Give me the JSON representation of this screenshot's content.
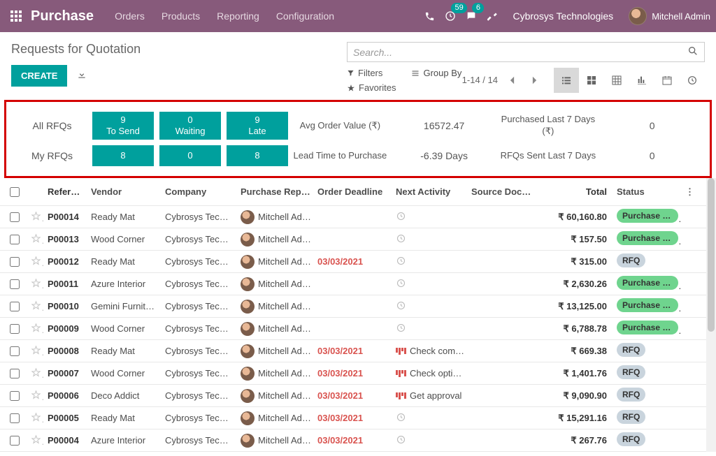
{
  "nav": {
    "brand": "Purchase",
    "links": [
      "Orders",
      "Products",
      "Reporting",
      "Configuration"
    ],
    "msg_badge": "59",
    "chat_badge": "6",
    "company": "Cybrosys Technologies",
    "user": "Mitchell Admin"
  },
  "header": {
    "title": "Requests for Quotation",
    "create": "CREATE",
    "search_ph": "Search...",
    "filters": "Filters",
    "groupby": "Group By",
    "favorites": "Favorites",
    "pager": "1-14 / 14"
  },
  "dash": {
    "all_label": "All RFQs",
    "my_label": "My RFQs",
    "all": [
      {
        "n": "9",
        "t": "To Send"
      },
      {
        "n": "0",
        "t": "Waiting"
      },
      {
        "n": "9",
        "t": "Late"
      }
    ],
    "my": [
      "8",
      "0",
      "8"
    ],
    "avg_lbl": "Avg Order Value (₹)",
    "avg_val": "16572.47",
    "lead_lbl": "Lead Time to Purchase",
    "lead_val": "-6.39  Days",
    "pur_lbl": "Purchased Last 7 Days (₹)",
    "pur_val": "0",
    "sent_lbl": "RFQs Sent Last 7 Days",
    "sent_val": "0"
  },
  "cols": {
    "ref": "Referen…",
    "vendor": "Vendor",
    "company": "Company",
    "rep": "Purchase Rep…",
    "deadline": "Order Deadline",
    "activity": "Next Activity",
    "src": "Source Docu…",
    "total": "Total",
    "status": "Status"
  },
  "rows": [
    {
      "ref": "P00014",
      "vendor": "Ready Mat",
      "company": "Cybrosys Techn…",
      "rep": "Mitchell Ad…",
      "deadline": "",
      "overdue": false,
      "act": "",
      "act_t": "clock",
      "total": "₹ 60,160.80",
      "status": "Purchase Or…",
      "st": "po"
    },
    {
      "ref": "P00013",
      "vendor": "Wood Corner",
      "company": "Cybrosys Techn…",
      "rep": "Mitchell Ad…",
      "deadline": "",
      "overdue": false,
      "act": "",
      "act_t": "clock",
      "total": "₹ 157.50",
      "status": "Purchase Or…",
      "st": "po"
    },
    {
      "ref": "P00012",
      "vendor": "Ready Mat",
      "company": "Cybrosys Techn…",
      "rep": "Mitchell Ad…",
      "deadline": "03/03/2021",
      "overdue": true,
      "act": "",
      "act_t": "clock",
      "total": "₹ 315.00",
      "status": "RFQ",
      "st": "rfq"
    },
    {
      "ref": "P00011",
      "vendor": "Azure Interior",
      "company": "Cybrosys Techn…",
      "rep": "Mitchell Ad…",
      "deadline": "",
      "overdue": false,
      "act": "",
      "act_t": "clock",
      "total": "₹ 2,630.26",
      "status": "Purchase Or…",
      "st": "po"
    },
    {
      "ref": "P00010",
      "vendor": "Gemini Furniture",
      "company": "Cybrosys Techn…",
      "rep": "Mitchell Ad…",
      "deadline": "",
      "overdue": false,
      "act": "",
      "act_t": "clock",
      "total": "₹ 13,125.00",
      "status": "Purchase Or…",
      "st": "po"
    },
    {
      "ref": "P00009",
      "vendor": "Wood Corner",
      "company": "Cybrosys Techn…",
      "rep": "Mitchell Ad…",
      "deadline": "",
      "overdue": false,
      "act": "",
      "act_t": "clock",
      "total": "₹ 6,788.78",
      "status": "Purchase Or…",
      "st": "po"
    },
    {
      "ref": "P00008",
      "vendor": "Ready Mat",
      "company": "Cybrosys Techn…",
      "rep": "Mitchell Ad…",
      "deadline": "03/03/2021",
      "overdue": true,
      "act": "Check com…",
      "act_t": "bars",
      "total": "₹ 669.38",
      "status": "RFQ",
      "st": "rfq"
    },
    {
      "ref": "P00007",
      "vendor": "Wood Corner",
      "company": "Cybrosys Techn…",
      "rep": "Mitchell Ad…",
      "deadline": "03/03/2021",
      "overdue": true,
      "act": "Check opti…",
      "act_t": "bars",
      "total": "₹ 1,401.76",
      "status": "RFQ",
      "st": "rfq"
    },
    {
      "ref": "P00006",
      "vendor": "Deco Addict",
      "company": "Cybrosys Techn…",
      "rep": "Mitchell Ad…",
      "deadline": "03/03/2021",
      "overdue": true,
      "act": "Get approval",
      "act_t": "bars",
      "total": "₹ 9,090.90",
      "status": "RFQ",
      "st": "rfq"
    },
    {
      "ref": "P00005",
      "vendor": "Ready Mat",
      "company": "Cybrosys Techn…",
      "rep": "Mitchell Ad…",
      "deadline": "03/03/2021",
      "overdue": true,
      "act": "",
      "act_t": "clock",
      "total": "₹ 15,291.16",
      "status": "RFQ",
      "st": "rfq"
    },
    {
      "ref": "P00004",
      "vendor": "Azure Interior",
      "company": "Cybrosys Techn…",
      "rep": "Mitchell Ad…",
      "deadline": "03/03/2021",
      "overdue": true,
      "act": "",
      "act_t": "clock",
      "total": "₹ 267.76",
      "status": "RFQ",
      "st": "rfq"
    }
  ]
}
